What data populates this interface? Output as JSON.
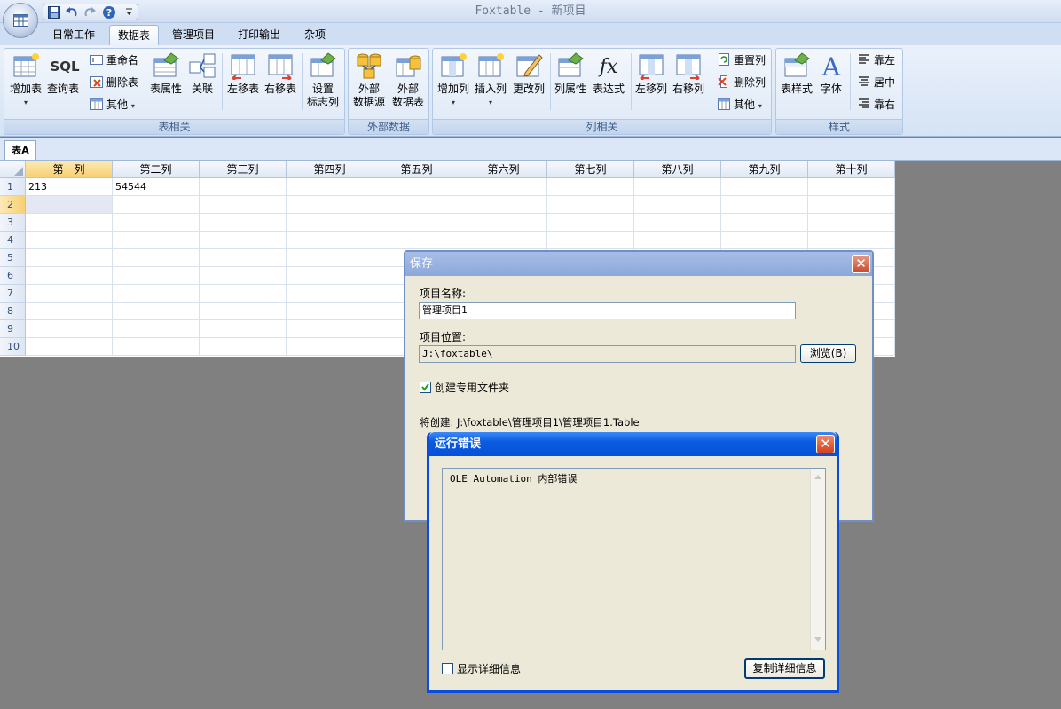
{
  "window": {
    "title": "Foxtable - 新项目"
  },
  "ribbon": {
    "tabs": [
      "日常工作",
      "数据表",
      "管理项目",
      "打印输出",
      "杂项"
    ],
    "active_tab": "数据表",
    "groups": {
      "table": {
        "label": "表相关",
        "add_table": "增加表",
        "query_table": "查询表",
        "sql_text": "SQL",
        "rename": "重命名",
        "delete_table": "删除表",
        "other": "其他",
        "table_props": "表属性",
        "relation": "关联",
        "move_left": "左移表",
        "move_right": "右移表",
        "flag_col_1": "设置",
        "flag_col_2": "标志列"
      },
      "external": {
        "label": "外部数据",
        "ext_source_1": "外部",
        "ext_source_2": "数据源",
        "ext_table_1": "外部",
        "ext_table_2": "数据表"
      },
      "column": {
        "label": "列相关",
        "add_col": "增加列",
        "insert_col": "插入列",
        "change_col": "更改列",
        "col_props": "列属性",
        "expression": "表达式",
        "move_left": "左移列",
        "move_right": "右移列",
        "reset_col": "重置列",
        "delete_col": "删除列",
        "other": "其他",
        "fx_text": "fx"
      },
      "style": {
        "label": "样式",
        "table_style": "表样式",
        "font": "字体",
        "align_left": "靠左",
        "align_center": "居中",
        "align_right": "靠右"
      }
    }
  },
  "sheet": {
    "tab": "表A",
    "columns": [
      "第一列",
      "第二列",
      "第三列",
      "第四列",
      "第五列",
      "第六列",
      "第七列",
      "第八列",
      "第九列",
      "第十列"
    ],
    "rows": [
      [
        "213",
        "54544",
        "",
        "",
        "",
        "",
        "",
        "",
        "",
        ""
      ],
      [
        "",
        "",
        "",
        "",
        "",
        "",
        "",
        "",
        "",
        ""
      ],
      [
        "",
        "",
        "",
        "",
        "",
        "",
        "",
        "",
        "",
        ""
      ],
      [
        "",
        "",
        "",
        "",
        "",
        "",
        "",
        "",
        "",
        ""
      ],
      [
        "",
        "",
        "",
        "",
        "",
        "",
        "",
        "",
        "",
        ""
      ],
      [
        "",
        "",
        "",
        "",
        "",
        "",
        "",
        "",
        "",
        ""
      ],
      [
        "",
        "",
        "",
        "",
        "",
        "",
        "",
        "",
        "",
        ""
      ],
      [
        "",
        "",
        "",
        "",
        "",
        "",
        "",
        "",
        "",
        ""
      ],
      [
        "",
        "",
        "",
        "",
        "",
        "",
        "",
        "",
        "",
        ""
      ],
      [
        "",
        "",
        "",
        "",
        "",
        "",
        "",
        "",
        "",
        ""
      ]
    ],
    "row_numbers": [
      "1",
      "2",
      "3",
      "4",
      "5",
      "6",
      "7",
      "8",
      "9",
      "10"
    ]
  },
  "save_dialog": {
    "title": "保存",
    "name_label": "项目名称:",
    "name_value": "管理项目1",
    "location_label": "项目位置:",
    "location_value": "J:\\foxtable\\",
    "browse": "浏览(B)",
    "create_folder": "创建专用文件夹",
    "create_folder_checked": true,
    "will_create": "将创建: J:\\foxtable\\管理项目1\\管理项目1.Table"
  },
  "error_dialog": {
    "title": "运行错误",
    "message": "OLE Automation 内部错误",
    "show_details": "显示详细信息",
    "show_details_checked": false,
    "copy_details": "复制详细信息"
  },
  "colors": {
    "accent": "#0a5be0",
    "selected_header": "#f8cf72",
    "ribbon_bg": "#dde8f6"
  }
}
